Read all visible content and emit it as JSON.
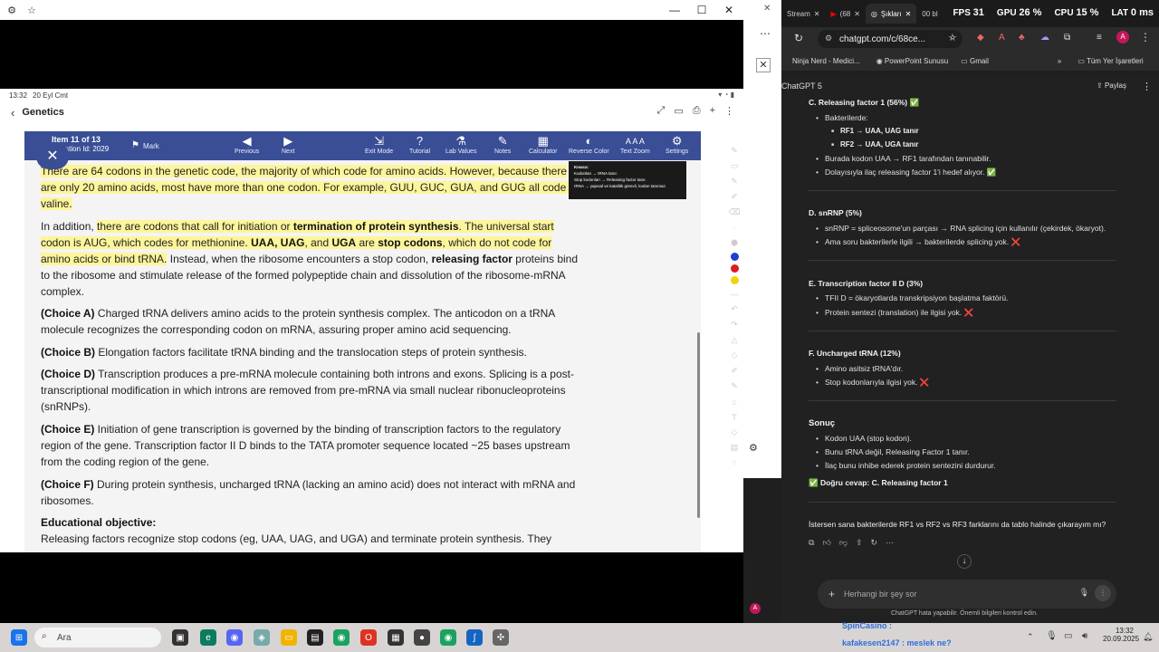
{
  "left_window": {
    "status_time": "13:32",
    "status_date": "20 Eyl Cmt",
    "app_title": "Genetics",
    "header": {
      "item": "Item 11 of 13",
      "question_id": "Question Id: 2029",
      "mark": "Mark",
      "previous": "Previous",
      "next": "Next",
      "exit_mode": "Exit Mode",
      "tutorial": "Tutorial",
      "lab_values": "Lab Values",
      "notes": "Notes",
      "calculator": "Calculator",
      "reverse_color": "Reverse Color",
      "text_zoom": "Text Zoom",
      "settings": "Settings",
      "zoom_letters": "A A A"
    },
    "tooltip_lines": [
      "Kısaca:",
      "Kodonları → tRNA tanır.",
      "Stop kodonları → Releasing factor tanır.",
      "rRNA → yapısal ve katalitik görevli, kodon tanımaz."
    ],
    "paragraphs": {
      "p1": "There are 64 codons in the genetic code, the majority of which code for amino acids.  However, because there are only 20 amino acids, most have more than one codon.  For example, GUU, GUC, GUA, and GUG all code for valine.",
      "p2_a": "In addition, ",
      "p2_b": "there are codons that call for initiation or ",
      "p2_c": "termination of protein synthesis",
      "p2_d": ".  The universal start codon is AUG, which codes for methionine.  ",
      "p2_e": "UAA, UAG",
      "p2_f": ", and ",
      "p2_g": "UGA",
      "p2_h": " are ",
      "p2_i": "stop codons",
      "p2_j": ", which do not code for amino acids or bind tRNA.",
      "p2_k": "  Instead, when the ribosome encounters a stop codon, ",
      "p2_l": "releasing factor",
      "p2_m": " proteins bind to the ribosome and stimulate release of the formed polypeptide chain and dissolution of the ribosome-mRNA complex.",
      "choiceA_label": "(Choice A)",
      "choiceA": "  Charged tRNA delivers amino acids to the protein synthesis complex.  The anticodon on a tRNA molecule recognizes the corresponding codon on mRNA, assuring proper amino acid sequencing.",
      "choiceB_label": "(Choice B)",
      "choiceB": "  Elongation factors facilitate tRNA binding and the translocation steps of protein synthesis.",
      "choiceD_label": "(Choice D)",
      "choiceD": "  Transcription produces a pre-mRNA molecule containing both introns and exons.  Splicing is a post-transcriptional modification in which introns are removed from pre-mRNA via small nuclear ribonucleoproteins (snRNPs).",
      "choiceE_label": "(Choice E)",
      "choiceE": "  Initiation of gene transcription is governed by the binding of transcription factors to the regulatory region of the gene.  Transcription factor II D binds to the TATA promoter sequence located ~25 bases upstream from the coding region of the gene.",
      "choiceF_label": "(Choice F)",
      "choiceF": "  During protein synthesis, uncharged tRNA (lacking an amino acid) does not interact with mRNA and ribosomes.",
      "edu_label": "Educational objective:",
      "edu": "Releasing factors recognize stop codons (eg, UAA, UAG, and UGA) and terminate protein synthesis.  They"
    }
  },
  "browser": {
    "tabs": [
      "Stream",
      "(68",
      "Şıkları",
      "00 bl"
    ],
    "stats": {
      "fps_label": "FPS",
      "fps": "31",
      "gpu_label": "GPU",
      "gpu": "26 %",
      "cpu_label": "CPU",
      "cpu": "15 %",
      "lat_label": "LAT",
      "lat": "0 ms"
    },
    "url": "chatgpt.com/c/68ce...",
    "bookmarks": [
      "Ninja Nerd - Medici...",
      "PowerPoint Sunusu",
      "Gmail",
      "Tüm Yer İşaretleri"
    ],
    "model": "ChatGPT 5",
    "share": "Paylaş"
  },
  "chat": {
    "c_head": "C. Releasing factor 1 (56%) ✅",
    "c_b1": "Bakterilerde:",
    "c_b1a": "RF1 → UAA, UAG tanır",
    "c_b1b": "RF2 → UAA, UGA tanır",
    "c_b2": "Burada kodon UAA → RF1 tarafından tanınabilir.",
    "c_b3": "Dolayısıyla ilaç releasing factor 1'i hedef alıyor. ✅",
    "d_head": "D. snRNP (5%)",
    "d_b1": "snRNP = spliceosome'un parçası → RNA splicing için kullanılır (çekirdek, ökaryot).",
    "d_b2": "Ama soru bakterilerle ilgili → bakterilerde splicing yok. ❌",
    "e_head": "E. Transcription factor II D (3%)",
    "e_b1": "TFII D = ökaryotlarda transkripsiyon başlatma faktörü.",
    "e_b2": "Protein sentezi (translation) ile ilgisi yok. ❌",
    "f_head": "F. Uncharged tRNA (12%)",
    "f_b1": "Amino asitsiz tRNA'dır.",
    "f_b2": "Stop kodonlarıyla ilgisi yok. ❌",
    "s_head": "Sonuç",
    "s_b1": "Kodon UAA (stop kodon).",
    "s_b2": "Bunu tRNA değil, Releasing Factor 1 tanır.",
    "s_b3": "İlaç bunu inhibe ederek protein sentezini durdurur.",
    "s_answer": "✅ Doğru cevap: C. Releasing factor 1",
    "followup": "İstersen sana bakterilerde RF1 vs RF2 vs RF3 farklarını da tablo halinde çıkarayım mı?",
    "composer_placeholder": "Herhangi bir şey sor",
    "disclaimer": "ChatGPT hata yapabilir. Önemli bilgileri kontrol edin."
  },
  "taskbar": {
    "search": "Ara",
    "time": "13:32",
    "date": "20.09.2025",
    "overlay_1": "SpinCasino :",
    "overlay_2": "kafakesen2147 : meslek ne?"
  },
  "colors": {
    "header_blue": "#3a4e96",
    "highlight": "#fdf59a",
    "chat_bg": "#212121"
  }
}
